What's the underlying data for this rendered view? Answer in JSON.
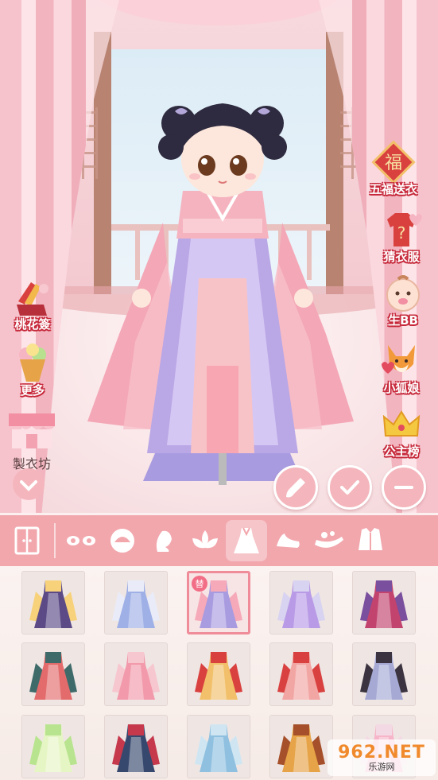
{
  "side_left": [
    {
      "label": "桃花簽",
      "icon": "peach-blossom-sticks-icon"
    },
    {
      "label": "更多",
      "icon": "ice-cream-icon"
    },
    {
      "label": "製衣坊",
      "icon": "tailor-shop-icon"
    }
  ],
  "side_right": [
    {
      "label": "五福送衣",
      "icon": "fu-blessing-icon",
      "glyph": "福"
    },
    {
      "label": "猜衣服",
      "icon": "guess-shirt-icon"
    },
    {
      "label": "生BB",
      "icon": "baby-icon"
    },
    {
      "label": "小狐娘",
      "icon": "fox-icon"
    },
    {
      "label": "公主榜",
      "icon": "crown-icon"
    }
  ],
  "categories": [
    {
      "name": "wardrobe-icon"
    },
    {
      "name": "eyes-icon"
    },
    {
      "name": "hair-icon"
    },
    {
      "name": "face-icon"
    },
    {
      "name": "lotus-icon"
    },
    {
      "name": "dress-icon",
      "active": true
    },
    {
      "name": "shoe-icon"
    },
    {
      "name": "hand-item-icon"
    },
    {
      "name": "jacket-icon"
    }
  ],
  "items": [
    {
      "colors": [
        "#f7d27a",
        "#5b4a86"
      ]
    },
    {
      "colors": [
        "#e9ecf8",
        "#9fb0e6"
      ]
    },
    {
      "colors": [
        "#f6a9b8",
        "#a99be0"
      ],
      "selected": true,
      "badge": "替"
    },
    {
      "colors": [
        "#d8d3f0",
        "#b89ae6"
      ]
    },
    {
      "colors": [
        "#7a4f9e",
        "#c2436e"
      ]
    },
    {
      "colors": [
        "#3e6b6a",
        "#e36b6b"
      ]
    },
    {
      "colors": [
        "#f6c7cf",
        "#f29aab"
      ]
    },
    {
      "colors": [
        "#d9413f",
        "#f2c06a"
      ]
    },
    {
      "colors": [
        "#d8413f",
        "#f2a6a4"
      ]
    },
    {
      "colors": [
        "#3b3440",
        "#a5a9d4"
      ]
    },
    {
      "colors": [
        "#b9e48f",
        "#e6f5c4"
      ]
    },
    {
      "colors": [
        "#c6384c",
        "#37486e"
      ]
    },
    {
      "colors": [
        "#cfe6f2",
        "#8fc0e0"
      ]
    },
    {
      "colors": [
        "#a5502a",
        "#e6a347"
      ]
    },
    {
      "colors": [
        "#f3d9e3",
        "#f7b5c9"
      ]
    }
  ],
  "watermark": {
    "main": "962.NET",
    "sub": "乐游网"
  }
}
